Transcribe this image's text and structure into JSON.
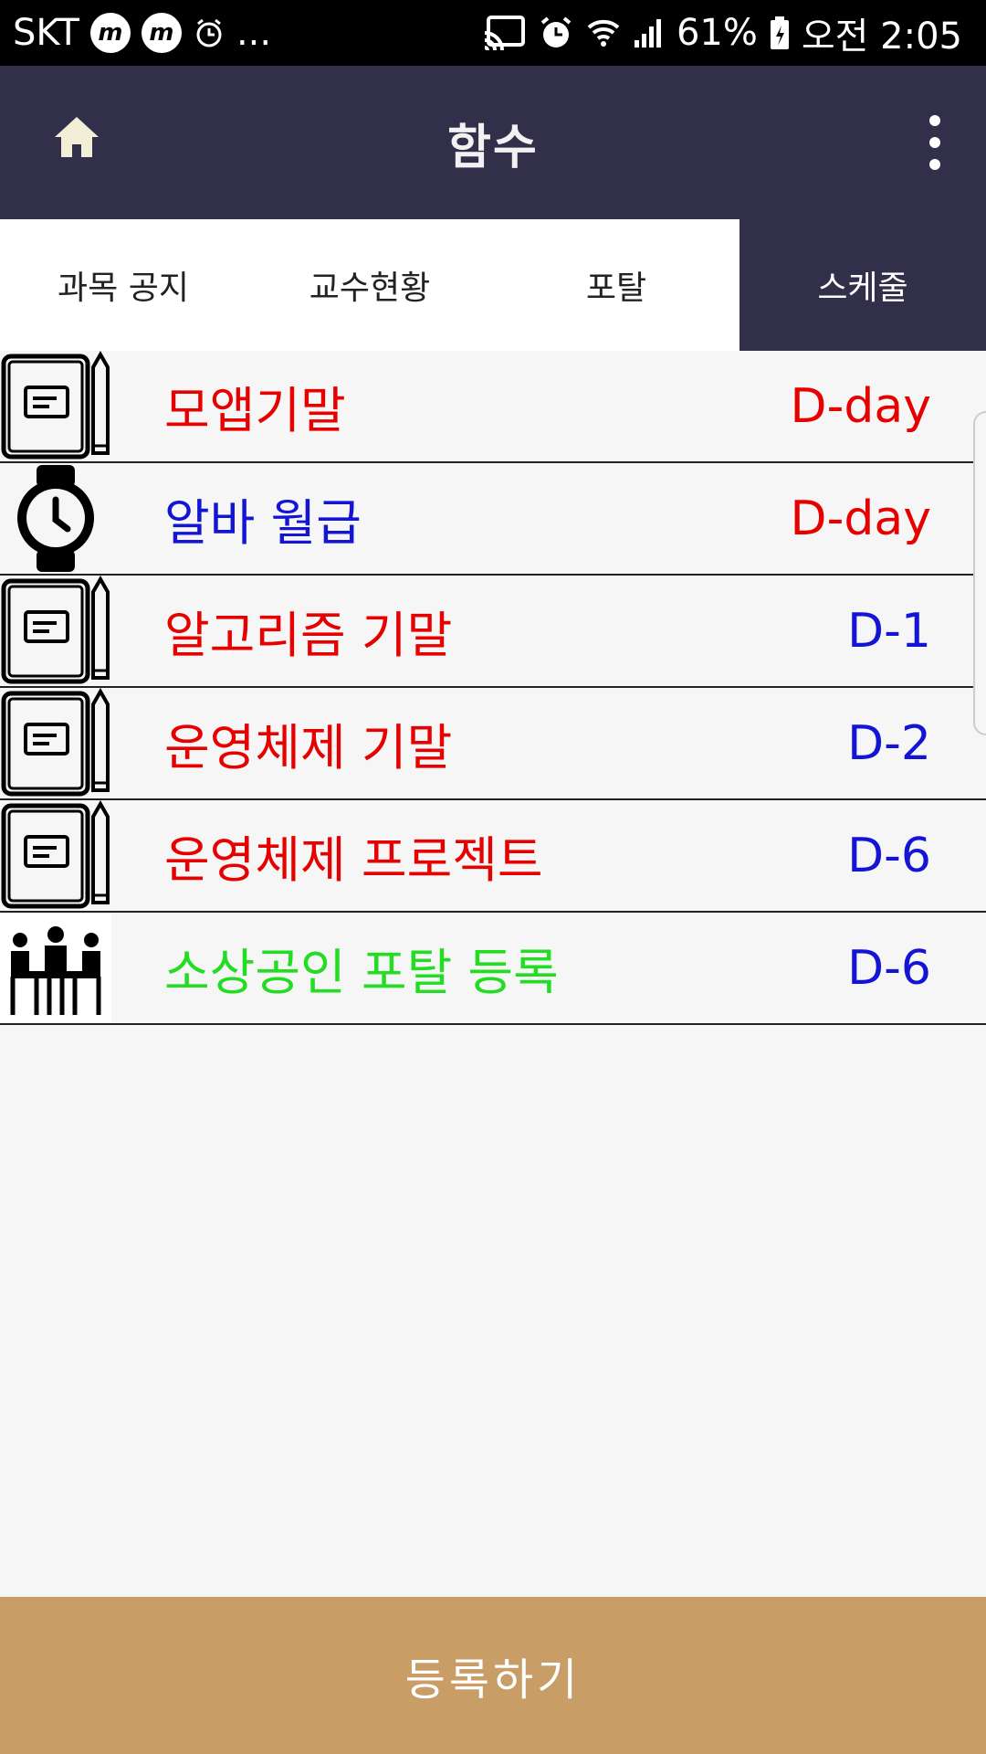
{
  "status_bar": {
    "carrier": "SKT",
    "notification_icons": [
      "messenger-m-icon",
      "messenger-m-icon",
      "alarm-icon"
    ],
    "more": "...",
    "battery": "61%",
    "time": "오전 2:05"
  },
  "app_bar": {
    "title": "함수"
  },
  "tabs": [
    {
      "label": "과목 공지",
      "active": false
    },
    {
      "label": "교수현황",
      "active": false
    },
    {
      "label": "포탈",
      "active": false
    },
    {
      "label": "스케줄",
      "active": true
    }
  ],
  "schedule": [
    {
      "icon": "notebook-icon",
      "title": "모앱기말",
      "title_color": "#e60000",
      "dday": "D-day",
      "dday_color": "#e60000"
    },
    {
      "icon": "watch-icon",
      "title": "알바 월급",
      "title_color": "#1414d6",
      "dday": "D-day",
      "dday_color": "#e60000"
    },
    {
      "icon": "notebook-icon",
      "title": "알고리즘 기말",
      "title_color": "#e60000",
      "dday": "D-1",
      "dday_color": "#1414d6"
    },
    {
      "icon": "notebook-icon",
      "title": "운영체제 기말",
      "title_color": "#e60000",
      "dday": "D-2",
      "dday_color": "#1414d6"
    },
    {
      "icon": "notebook-icon",
      "title": "운영체제 프로젝트",
      "title_color": "#e60000",
      "dday": "D-6",
      "dday_color": "#1414d6"
    },
    {
      "icon": "meeting-icon",
      "title": "소상공인 포탈 등록",
      "title_color": "#22dd22",
      "dday": "D-6",
      "dday_color": "#1414d6"
    }
  ],
  "register_button": {
    "label": "등록하기"
  },
  "colors": {
    "primary": "#322f4b",
    "accent": "#c99d66",
    "background": "#f6f6f6"
  }
}
